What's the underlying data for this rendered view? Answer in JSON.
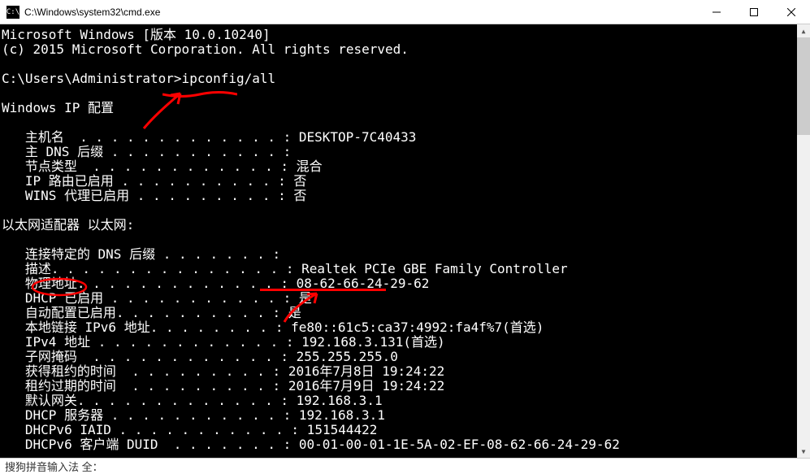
{
  "titlebar": {
    "icon_text": "C:\\",
    "title": "C:\\Windows\\system32\\cmd.exe"
  },
  "terminal": {
    "line1": "Microsoft Windows [版本 10.0.10240]",
    "line2": "(c) 2015 Microsoft Corporation. All rights reserved.",
    "blank1": "",
    "prompt_line": "C:\\Users\\Administrator>ipconfig/all",
    "blank2": "",
    "header1": "Windows IP 配置",
    "blank3": "",
    "hostname": "   主机名  . . . . . . . . . . . . . : DESKTOP-7C40433",
    "dnssuffix": "   主 DNS 后缀 . . . . . . . . . . . :",
    "nodetype": "   节点类型  . . . . . . . . . . . . : 混合",
    "iprouting": "   IP 路由已启用 . . . . . . . . . . : 否",
    "wins": "   WINS 代理已启用 . . . . . . . . . : 否",
    "blank4": "",
    "header2": "以太网适配器 以太网:",
    "blank5": "",
    "conndns": "   连接特定的 DNS 后缀 . . . . . . . :",
    "desc": "   描述. . . . . . . . . . . . . . . : Realtek PCIe GBE Family Controller",
    "mac": "   物理地址. . . . . . . . . . . . . : 08-62-66-24-29-62",
    "dhcp": "   DHCP 已启用 . . . . . . . . . . . : 是",
    "autoconf": "   自动配置已启用. . . . . . . . . . : 是",
    "linklocal": "   本地链接 IPv6 地址. . . . . . . . : fe80::61c5:ca37:4992:fa4f%7(首选)",
    "ipv4": "   IPv4 地址 . . . . . . . . . . . . : 192.168.3.131(首选)",
    "subnet": "   子网掩码  . . . . . . . . . . . . : 255.255.255.0",
    "leaseobt": "   获得租约的时间  . . . . . . . . . : 2016年7月8日 19:24:22",
    "leaseexp": "   租约过期的时间  . . . . . . . . . : 2016年7月9日 19:24:22",
    "gateway": "   默认网关. . . . . . . . . . . . . : 192.168.3.1",
    "dhcpsrv": "   DHCP 服务器 . . . . . . . . . . . : 192.168.3.1",
    "dhcpv6iaid": "   DHCPv6 IAID . . . . . . . . . . . : 151544422",
    "dhcpv6duid": "   DHCPv6 客户端 DUID  . . . . . . . : 00-01-00-01-1E-5A-02-EF-08-62-66-24-29-62"
  },
  "ime": {
    "text": "搜狗拼音输入法 全："
  }
}
